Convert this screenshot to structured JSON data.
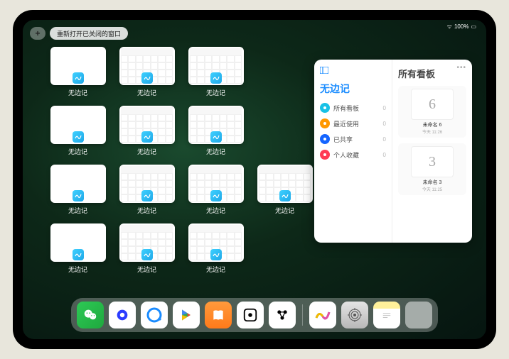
{
  "status": {
    "battery": "100%"
  },
  "topbar": {
    "plus": "+",
    "reopen_label": "重新打开已关闭的窗口"
  },
  "app_label": "无边记",
  "windows": [
    {
      "variant": "blank"
    },
    {
      "variant": "cal"
    },
    {
      "variant": "cal"
    },
    {
      "variant": "blank"
    },
    {
      "variant": "cal"
    },
    {
      "variant": "cal"
    },
    {
      "variant": "blank"
    },
    {
      "variant": "cal"
    },
    {
      "variant": "cal"
    },
    {
      "variant": "cal"
    },
    {
      "variant": "blank"
    },
    {
      "variant": "cal"
    },
    {
      "variant": "cal"
    }
  ],
  "panel": {
    "title": "无边记",
    "right_title": "所有看板",
    "categories": [
      {
        "label": "所有看板",
        "count": "0",
        "color": "#18c1e6"
      },
      {
        "label": "最近使用",
        "count": "0",
        "color": "#ff9800"
      },
      {
        "label": "已共享",
        "count": "0",
        "color": "#1565ff"
      },
      {
        "label": "个人收藏",
        "count": "0",
        "color": "#ff3b55"
      }
    ],
    "boards": [
      {
        "name": "未命名 6",
        "date": "今天 11:26",
        "glyph": "6"
      },
      {
        "name": "未命名 3",
        "date": "今天 11:25",
        "glyph": "3"
      }
    ]
  },
  "dock": {
    "items": [
      {
        "id": "wechat"
      },
      {
        "id": "quark"
      },
      {
        "id": "qqbrowser"
      },
      {
        "id": "play"
      },
      {
        "id": "books"
      },
      {
        "id": "obsidian"
      },
      {
        "id": "barcode"
      }
    ],
    "recent": [
      {
        "id": "freeform"
      },
      {
        "id": "settings"
      },
      {
        "id": "notes"
      },
      {
        "id": "app-library"
      }
    ]
  }
}
